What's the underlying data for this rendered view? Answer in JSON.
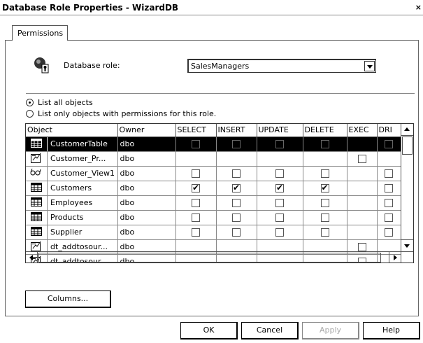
{
  "window": {
    "title": "Database Role Properties - WizardDB",
    "close_glyph": "×"
  },
  "tabs": [
    {
      "label": "Permissions"
    }
  ],
  "role": {
    "label": "Database role:",
    "value": "SalesManagers"
  },
  "options": {
    "list_all": "List all objects",
    "list_only": "List only objects with permissions for this role.",
    "selected": "list_all"
  },
  "grid": {
    "columns": [
      "Object",
      "Owner",
      "SELECT",
      "INSERT",
      "UPDATE",
      "DELETE",
      "EXEC",
      "DRI"
    ],
    "rows": [
      {
        "icon": "table-icon",
        "name": "CustomerTable",
        "owner": "dbo",
        "perm": {
          "SELECT": "off",
          "INSERT": "off",
          "UPDATE": "off",
          "DELETE": "off",
          "EXEC": "",
          "DRI": "off"
        },
        "selected": true
      },
      {
        "icon": "stored-procedure-icon",
        "name": "Customer_Pr...",
        "owner": "dbo",
        "perm": {
          "SELECT": "",
          "INSERT": "",
          "UPDATE": "",
          "DELETE": "",
          "EXEC": "off",
          "DRI": ""
        }
      },
      {
        "icon": "view-icon",
        "name": "Customer_View1",
        "owner": "dbo",
        "perm": {
          "SELECT": "off",
          "INSERT": "off",
          "UPDATE": "off",
          "DELETE": "off",
          "EXEC": "",
          "DRI": "off"
        }
      },
      {
        "icon": "table-icon",
        "name": "Customers",
        "owner": "dbo",
        "perm": {
          "SELECT": "on",
          "INSERT": "on",
          "UPDATE": "on",
          "DELETE": "on",
          "EXEC": "",
          "DRI": "off"
        }
      },
      {
        "icon": "table-icon",
        "name": "Employees",
        "owner": "dbo",
        "perm": {
          "SELECT": "off",
          "INSERT": "off",
          "UPDATE": "off",
          "DELETE": "off",
          "EXEC": "",
          "DRI": "off"
        }
      },
      {
        "icon": "table-icon",
        "name": "Products",
        "owner": "dbo",
        "perm": {
          "SELECT": "off",
          "INSERT": "off",
          "UPDATE": "off",
          "DELETE": "off",
          "EXEC": "",
          "DRI": "off"
        }
      },
      {
        "icon": "table-icon",
        "name": "Supplier",
        "owner": "dbo",
        "perm": {
          "SELECT": "off",
          "INSERT": "off",
          "UPDATE": "off",
          "DELETE": "off",
          "EXEC": "",
          "DRI": "off"
        }
      },
      {
        "icon": "stored-procedure-icon",
        "name": "dt_addtosour...",
        "owner": "dbo",
        "perm": {
          "SELECT": "",
          "INSERT": "",
          "UPDATE": "",
          "DELETE": "",
          "EXEC": "off",
          "DRI": ""
        }
      },
      {
        "icon": "stored-procedure-icon",
        "name": "dt_addtosour...",
        "owner": "dbo",
        "perm": {
          "SELECT": "",
          "INSERT": "",
          "UPDATE": "",
          "DELETE": "",
          "EXEC": "off",
          "DRI": ""
        }
      }
    ]
  },
  "buttons": {
    "columns": "Columns...",
    "ok": "OK",
    "cancel": "Cancel",
    "apply": "Apply",
    "help": "Help"
  }
}
